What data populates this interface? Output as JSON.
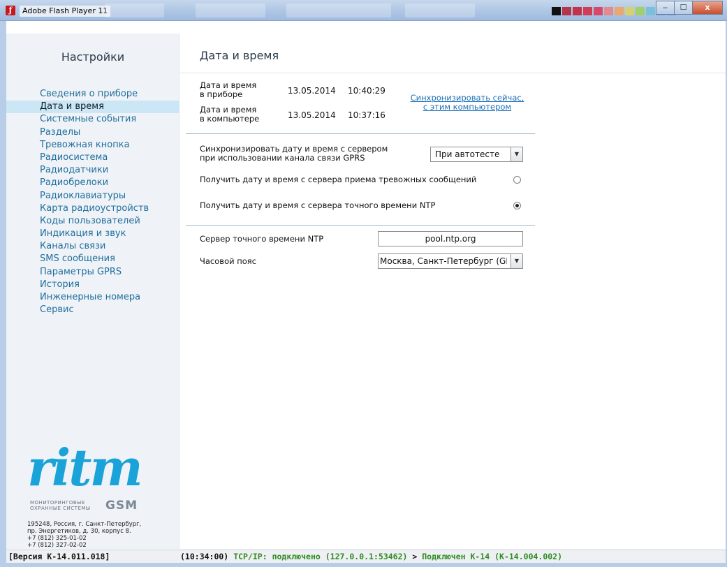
{
  "window": {
    "title": "Adobe Flash Player 11",
    "icon": "flash-player-icon",
    "controls": {
      "minimize": "‒",
      "maximize": "☐",
      "close": "x"
    },
    "swatch_colors": [
      "#111111",
      "#b4364b",
      "#c2334b",
      "#cf3e55",
      "#d8486a",
      "#e28b8f",
      "#e9a870",
      "#d8d070",
      "#9fd069",
      "#7ac0d8",
      "#6aa4e0",
      "#7c9bd8"
    ]
  },
  "sidebar": {
    "title": "Настройки",
    "items": [
      {
        "label": "Сведения о приборе",
        "active": false
      },
      {
        "label": "Дата и время",
        "active": true
      },
      {
        "label": "Системные события",
        "active": false
      },
      {
        "label": "Разделы",
        "active": false
      },
      {
        "label": "Тревожная кнопка",
        "active": false
      },
      {
        "label": "Радиосистема",
        "active": false
      },
      {
        "label": "Радиодатчики",
        "active": false
      },
      {
        "label": "Радиобрелоки",
        "active": false
      },
      {
        "label": "Радиоклавиатуры",
        "active": false
      },
      {
        "label": "Карта радиоустройств",
        "active": false
      },
      {
        "label": "Коды пользователей",
        "active": false
      },
      {
        "label": "Индикация и звук",
        "active": false
      },
      {
        "label": "Каналы связи",
        "active": false
      },
      {
        "label": "SMS сообщения",
        "active": false
      },
      {
        "label": "Параметры GPRS",
        "active": false
      },
      {
        "label": "История",
        "active": false
      },
      {
        "label": "Инженерные номера",
        "active": false
      },
      {
        "label": "Сервис",
        "active": false
      }
    ],
    "logo": {
      "word": "ritm",
      "subtitle_line1": "МОНИТОРИНГОВЫЕ",
      "subtitle_line2": "ОХРАННЫЕ СИСТЕМЫ",
      "gsm": "GSM"
    },
    "address": "195248, Россия, г. Санкт-Петербург,\nпр. Энергетиков, д. 30, корпус 8.\n+7 (812) 325-01-02\n+7 (812) 327-02-02"
  },
  "main": {
    "title": "Дата и время",
    "device_time": {
      "label_line1": "Дата и время",
      "label_line2": "в приборе",
      "date": "13.05.2014",
      "time": "10:40:29"
    },
    "computer_time": {
      "label_line1": "Дата и время",
      "label_line2": "в компьютере",
      "date": "13.05.2014",
      "time": "10:37:16"
    },
    "sync_link": {
      "line1": "Синхронизировать сейчас,",
      "line2": "с этим компьютером"
    },
    "gprs_sync": {
      "label_line1": "Синхронизировать дату и время с сервером",
      "label_line2": "при использовании канала связи GPRS",
      "selected": "При автотесте"
    },
    "alarm_server_option": {
      "label": "Получить дату и время с сервера приема тревожных сообщений",
      "checked": false
    },
    "ntp_option": {
      "label": "Получить дату и время с сервера точного времени NTP",
      "checked": true
    },
    "ntp_server": {
      "label": "Сервер точного времени NTP",
      "value": "pool.ntp.org"
    },
    "timezone": {
      "label": "Часовой пояс",
      "selected": "Москва, Санкт-Петербург (GMT"
    }
  },
  "statusbar": {
    "version": "[Версия К-14.011.018]",
    "time": "(10:34:00)",
    "connection": "TCP/IP: подключено (127.0.0.1:53462)",
    "arrow": ">",
    "device": "Подключен К-14 (К-14.004.002)",
    "colors": {
      "ok": "#2e8b22"
    }
  }
}
